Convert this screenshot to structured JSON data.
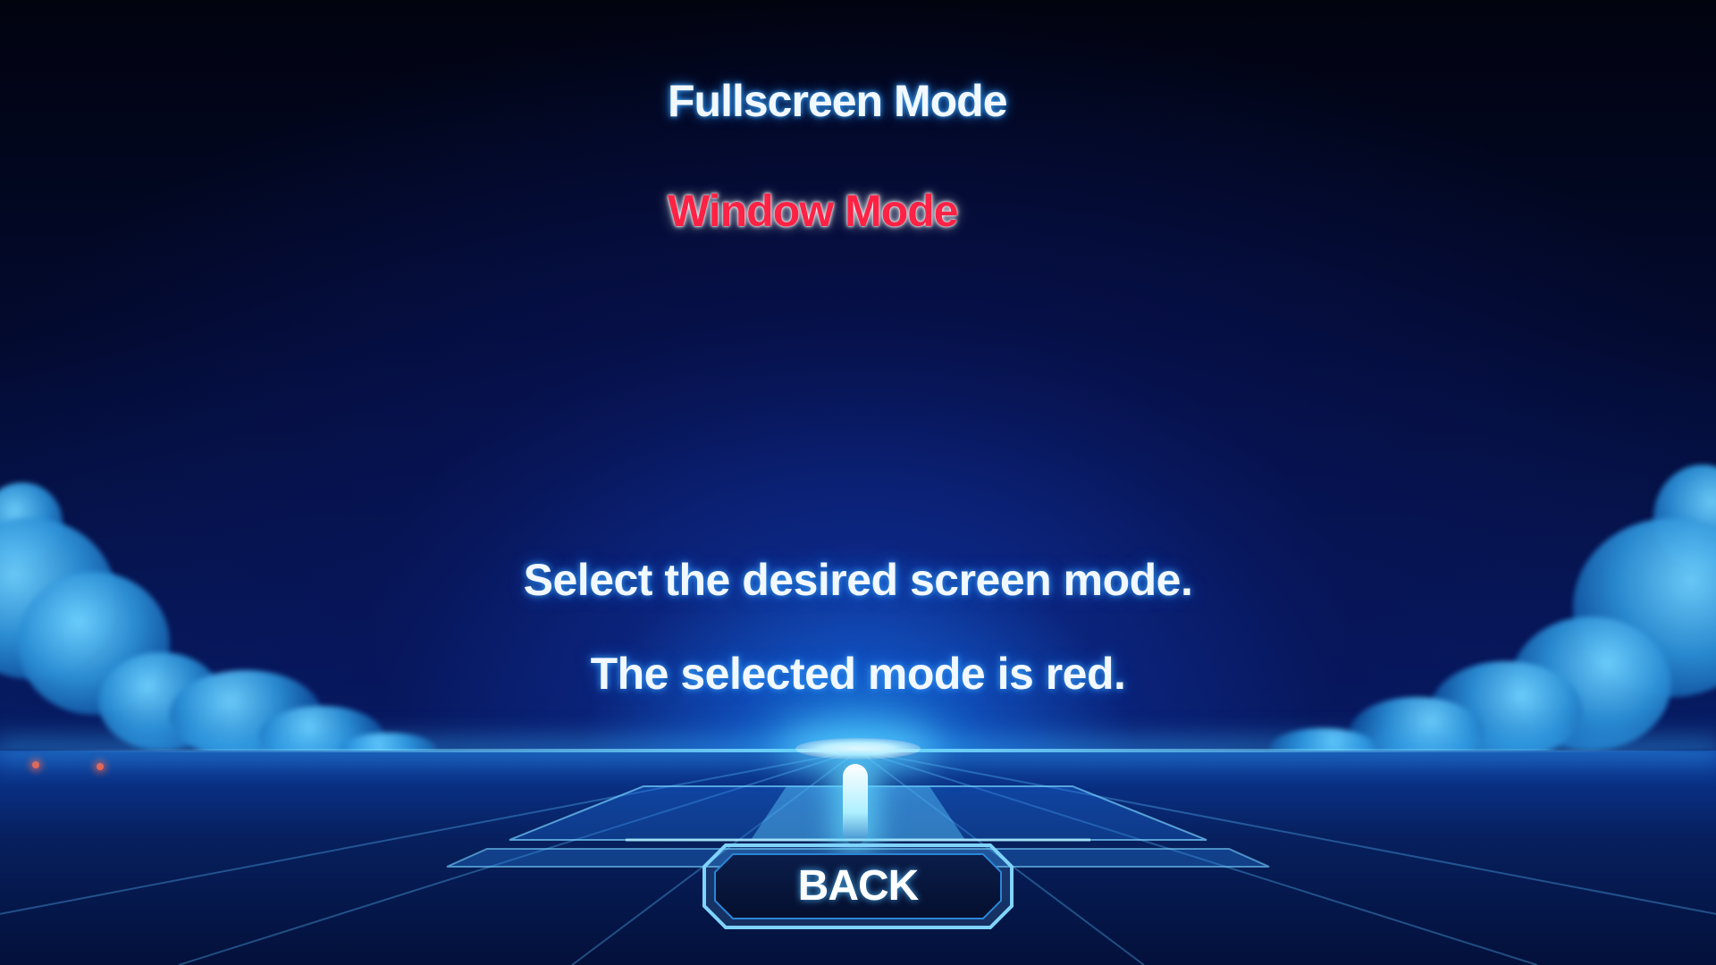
{
  "menu": {
    "fullscreen_label": "Fullscreen Mode",
    "window_label": "Window Mode",
    "selected": "Window Mode"
  },
  "instructions": {
    "line1": "Select the desired screen mode.",
    "line2": "The selected mode is red."
  },
  "back_button": {
    "label": "BACK"
  },
  "colors": {
    "selected_text": "#ff2244",
    "unselected_text": "#f2f8ff",
    "glow": "#3caaff",
    "background": "#02061a"
  }
}
